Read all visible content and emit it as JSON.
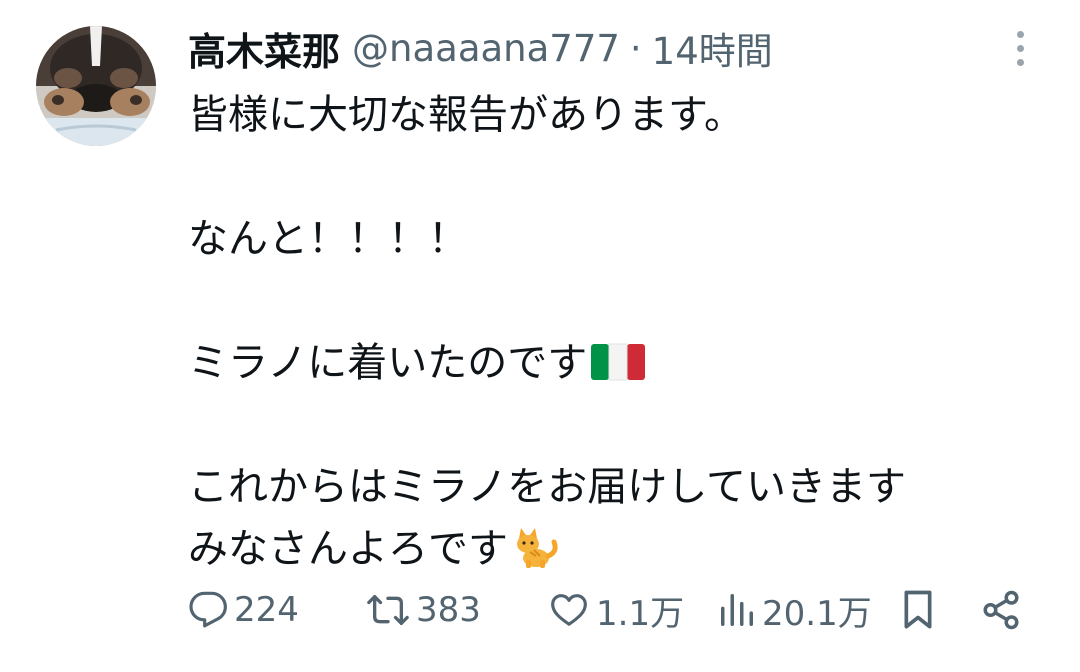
{
  "author": {
    "display_name": "高木菜那",
    "handle": "@naaaana777",
    "separator": "·",
    "time": "14時間"
  },
  "tweet": {
    "lines": [
      "皆様に大切な報告があります。",
      "",
      "なんと！！！！",
      "",
      "ミラノに着いたのです",
      "",
      "これからはミラノをお届けしていきます",
      "みなさんよろです"
    ],
    "emoji": {
      "line5": "flag-italy",
      "line8": "cat"
    }
  },
  "actions": {
    "replies": "224",
    "retweets": "383",
    "likes": "1.1万",
    "views": "20.1万"
  },
  "icons": {
    "more": "more-vertical-icon",
    "reply": "reply-icon",
    "retweet": "retweet-icon",
    "like": "heart-icon",
    "views": "views-icon",
    "bookmark": "bookmark-icon",
    "share": "share-icon"
  },
  "colors": {
    "text": "#0f1419",
    "secondary": "#536471",
    "more_dots": "#9aa4ad"
  }
}
